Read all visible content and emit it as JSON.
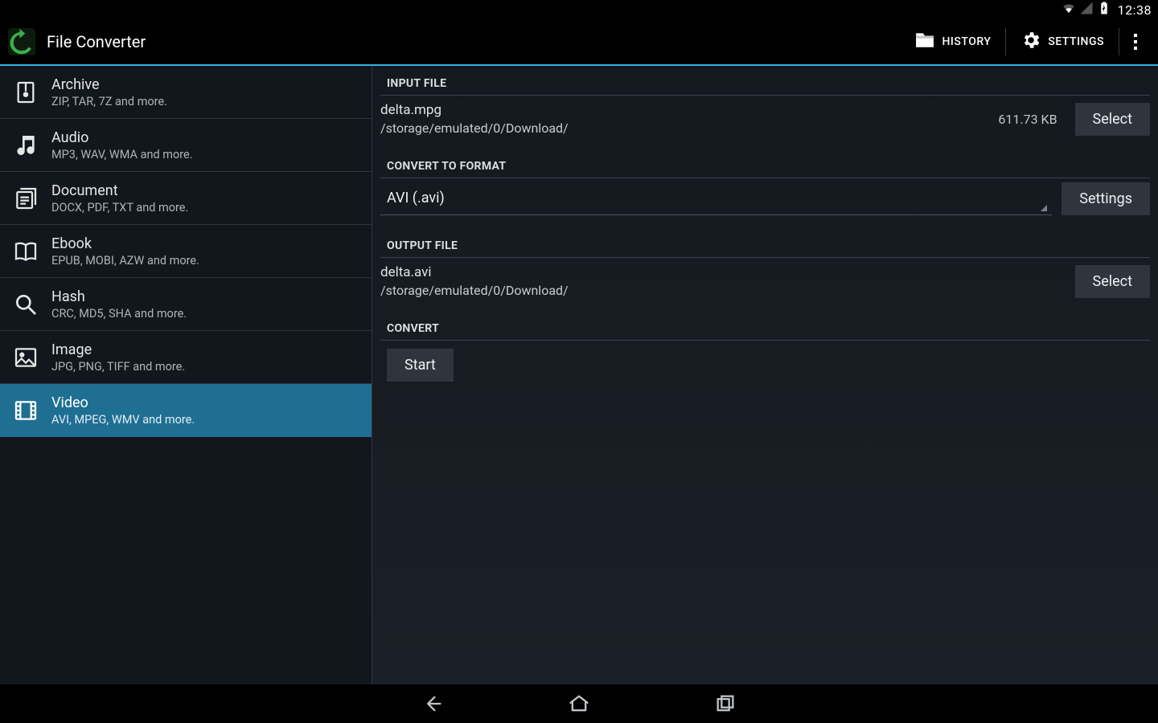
{
  "status": {
    "time": "12:38"
  },
  "actionbar": {
    "title": "File Converter",
    "history_label": "HISTORY",
    "settings_label": "SETTINGS"
  },
  "sidebar": {
    "items": [
      {
        "id": "archive",
        "title": "Archive",
        "sub": "ZIP, TAR, 7Z and more."
      },
      {
        "id": "audio",
        "title": "Audio",
        "sub": "MP3, WAV, WMA and more."
      },
      {
        "id": "document",
        "title": "Document",
        "sub": "DOCX, PDF, TXT and more."
      },
      {
        "id": "ebook",
        "title": "Ebook",
        "sub": "EPUB, MOBI, AZW and more."
      },
      {
        "id": "hash",
        "title": "Hash",
        "sub": "CRC, MD5, SHA and more."
      },
      {
        "id": "image",
        "title": "Image",
        "sub": "JPG, PNG, TIFF and more."
      },
      {
        "id": "video",
        "title": "Video",
        "sub": "AVI, MPEG, WMV and more."
      }
    ],
    "selected_index": 6
  },
  "sections": {
    "input": {
      "header": "INPUT FILE",
      "filename": "delta.mpg",
      "path": "/storage/emulated/0/Download/",
      "size": "611.73 KB",
      "select_label": "Select"
    },
    "format": {
      "header": "CONVERT TO FORMAT",
      "value": "AVI (.avi)",
      "settings_label": "Settings"
    },
    "output": {
      "header": "OUTPUT FILE",
      "filename": "delta.avi",
      "path": "/storage/emulated/0/Download/",
      "select_label": "Select"
    },
    "convert": {
      "header": "CONVERT",
      "start_label": "Start"
    }
  }
}
